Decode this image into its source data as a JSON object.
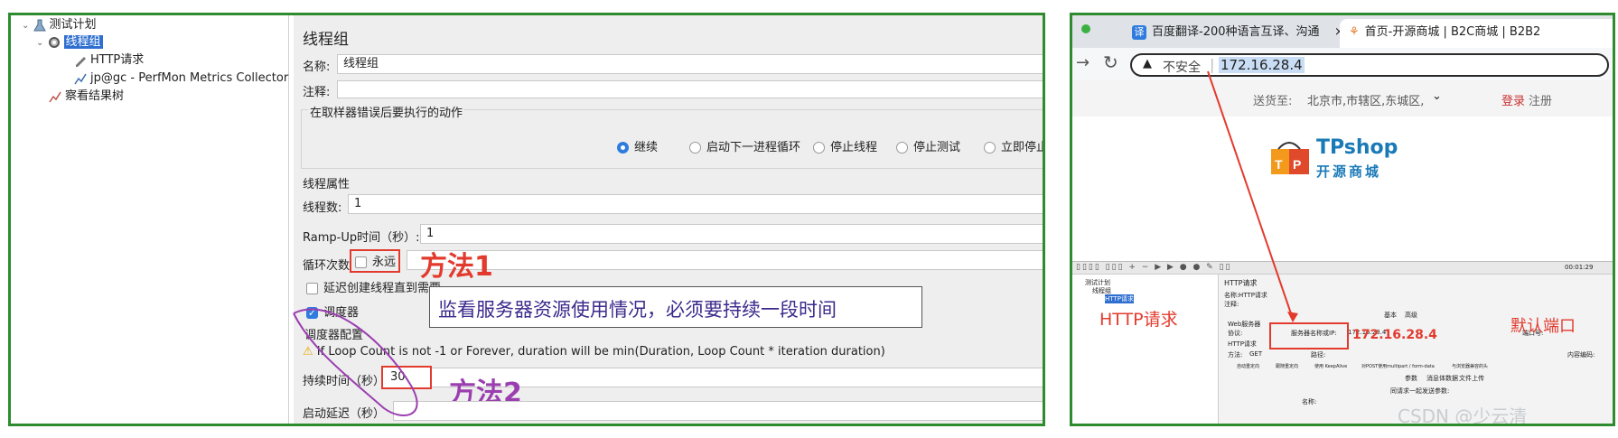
{
  "left": {
    "tree": {
      "items": [
        "测试计划",
        "线程组",
        "HTTP请求",
        "jp@gc - PerfMon Metrics Collector",
        "察看结果树"
      ]
    },
    "form": {
      "title": "线程组",
      "name_label": "名称:",
      "name_value": "线程组",
      "comment_label": "注释:",
      "error_action_title": "在取样器错误后要执行的动作",
      "error_options": [
        "继续",
        "启动下一进程循环",
        "停止线程",
        "停止测试",
        "立即停止"
      ],
      "selected_error_option": 0,
      "thread_props_title": "线程属性",
      "thread_count_label": "线程数:",
      "thread_count_value": "1",
      "rampup_label": "Ramp-Up时间（秒）:",
      "rampup_value": "1",
      "loop_label": "循环次数",
      "loop_forever_label": "永远",
      "delay_label": "延迟创建线程直到需要",
      "scheduler_label": "调度器",
      "scheduler_config_title": "调度器配置",
      "warning_text": "If Loop Count is not -1 or Forever, duration will be min(Duration, Loop Count * iteration duration)",
      "duration_label": "持续时间（秒）",
      "duration_value": "30",
      "startup_delay_label": "启动延迟（秒）"
    },
    "annotations": {
      "method1": "方法1",
      "method2": "方法2",
      "note": "监看服务器资源使用情况，必须要持续一段时间"
    }
  },
  "right": {
    "tabs": [
      {
        "title": "百度翻译-200种语言互译、沟通",
        "close": "×"
      },
      {
        "title": "首页-开源商城 | B2C商城 | B2B2",
        "close": "×"
      }
    ],
    "address": {
      "insecure_label": "不安全",
      "url": "172.16.28.4"
    },
    "site": {
      "deliver_label": "送货至:",
      "deliver_value": "北京市,市辖区,东城区,",
      "login": "登录",
      "register": "注册",
      "logo_main": "TPshop",
      "logo_sub": "开源商城"
    },
    "mini_jmeter": {
      "timer": "00:01:29",
      "tree_items": [
        "测试计划",
        "线程组",
        "HTTP请求"
      ],
      "title": "HTTP请求",
      "name_label": "名称:",
      "name_value": "HTTP请求",
      "comment_label": "注释:",
      "basic_tab": "基本",
      "advanced_tab": "高级",
      "web_server": "Web服务器",
      "protocol_label": "协议:",
      "server_label": "服务器名称或IP:",
      "server_value": "172.16.28.4",
      "port_label": "端口号:",
      "http_request": "HTTP请求",
      "method_label": "方法:",
      "method_value": "GET",
      "path_label": "路径:",
      "encoding_label": "内容编码:",
      "check1": "自动重定向",
      "check2": "跟随重定向",
      "check3": "使用 KeepAlive",
      "check4": "对POST使用multipart / form-data",
      "check5": "与浏览器兼容的头",
      "params_tab": "参数",
      "body_tab": "消息体数据",
      "files_tab": "文件上传",
      "send_params": "同请求一起发送参数:",
      "col_name": "名称:"
    },
    "annotations": {
      "http_request": "HTTP请求",
      "default_port": "默认端口",
      "ip": "172.16.28.4",
      "watermark": "CSDN @少云清"
    }
  },
  "colors": {
    "frame_green": "#2e8b2e",
    "annotation_red": "#e23b2e",
    "annotation_purple": "#9b3fb0",
    "radio_blue": "#2f7bde"
  }
}
